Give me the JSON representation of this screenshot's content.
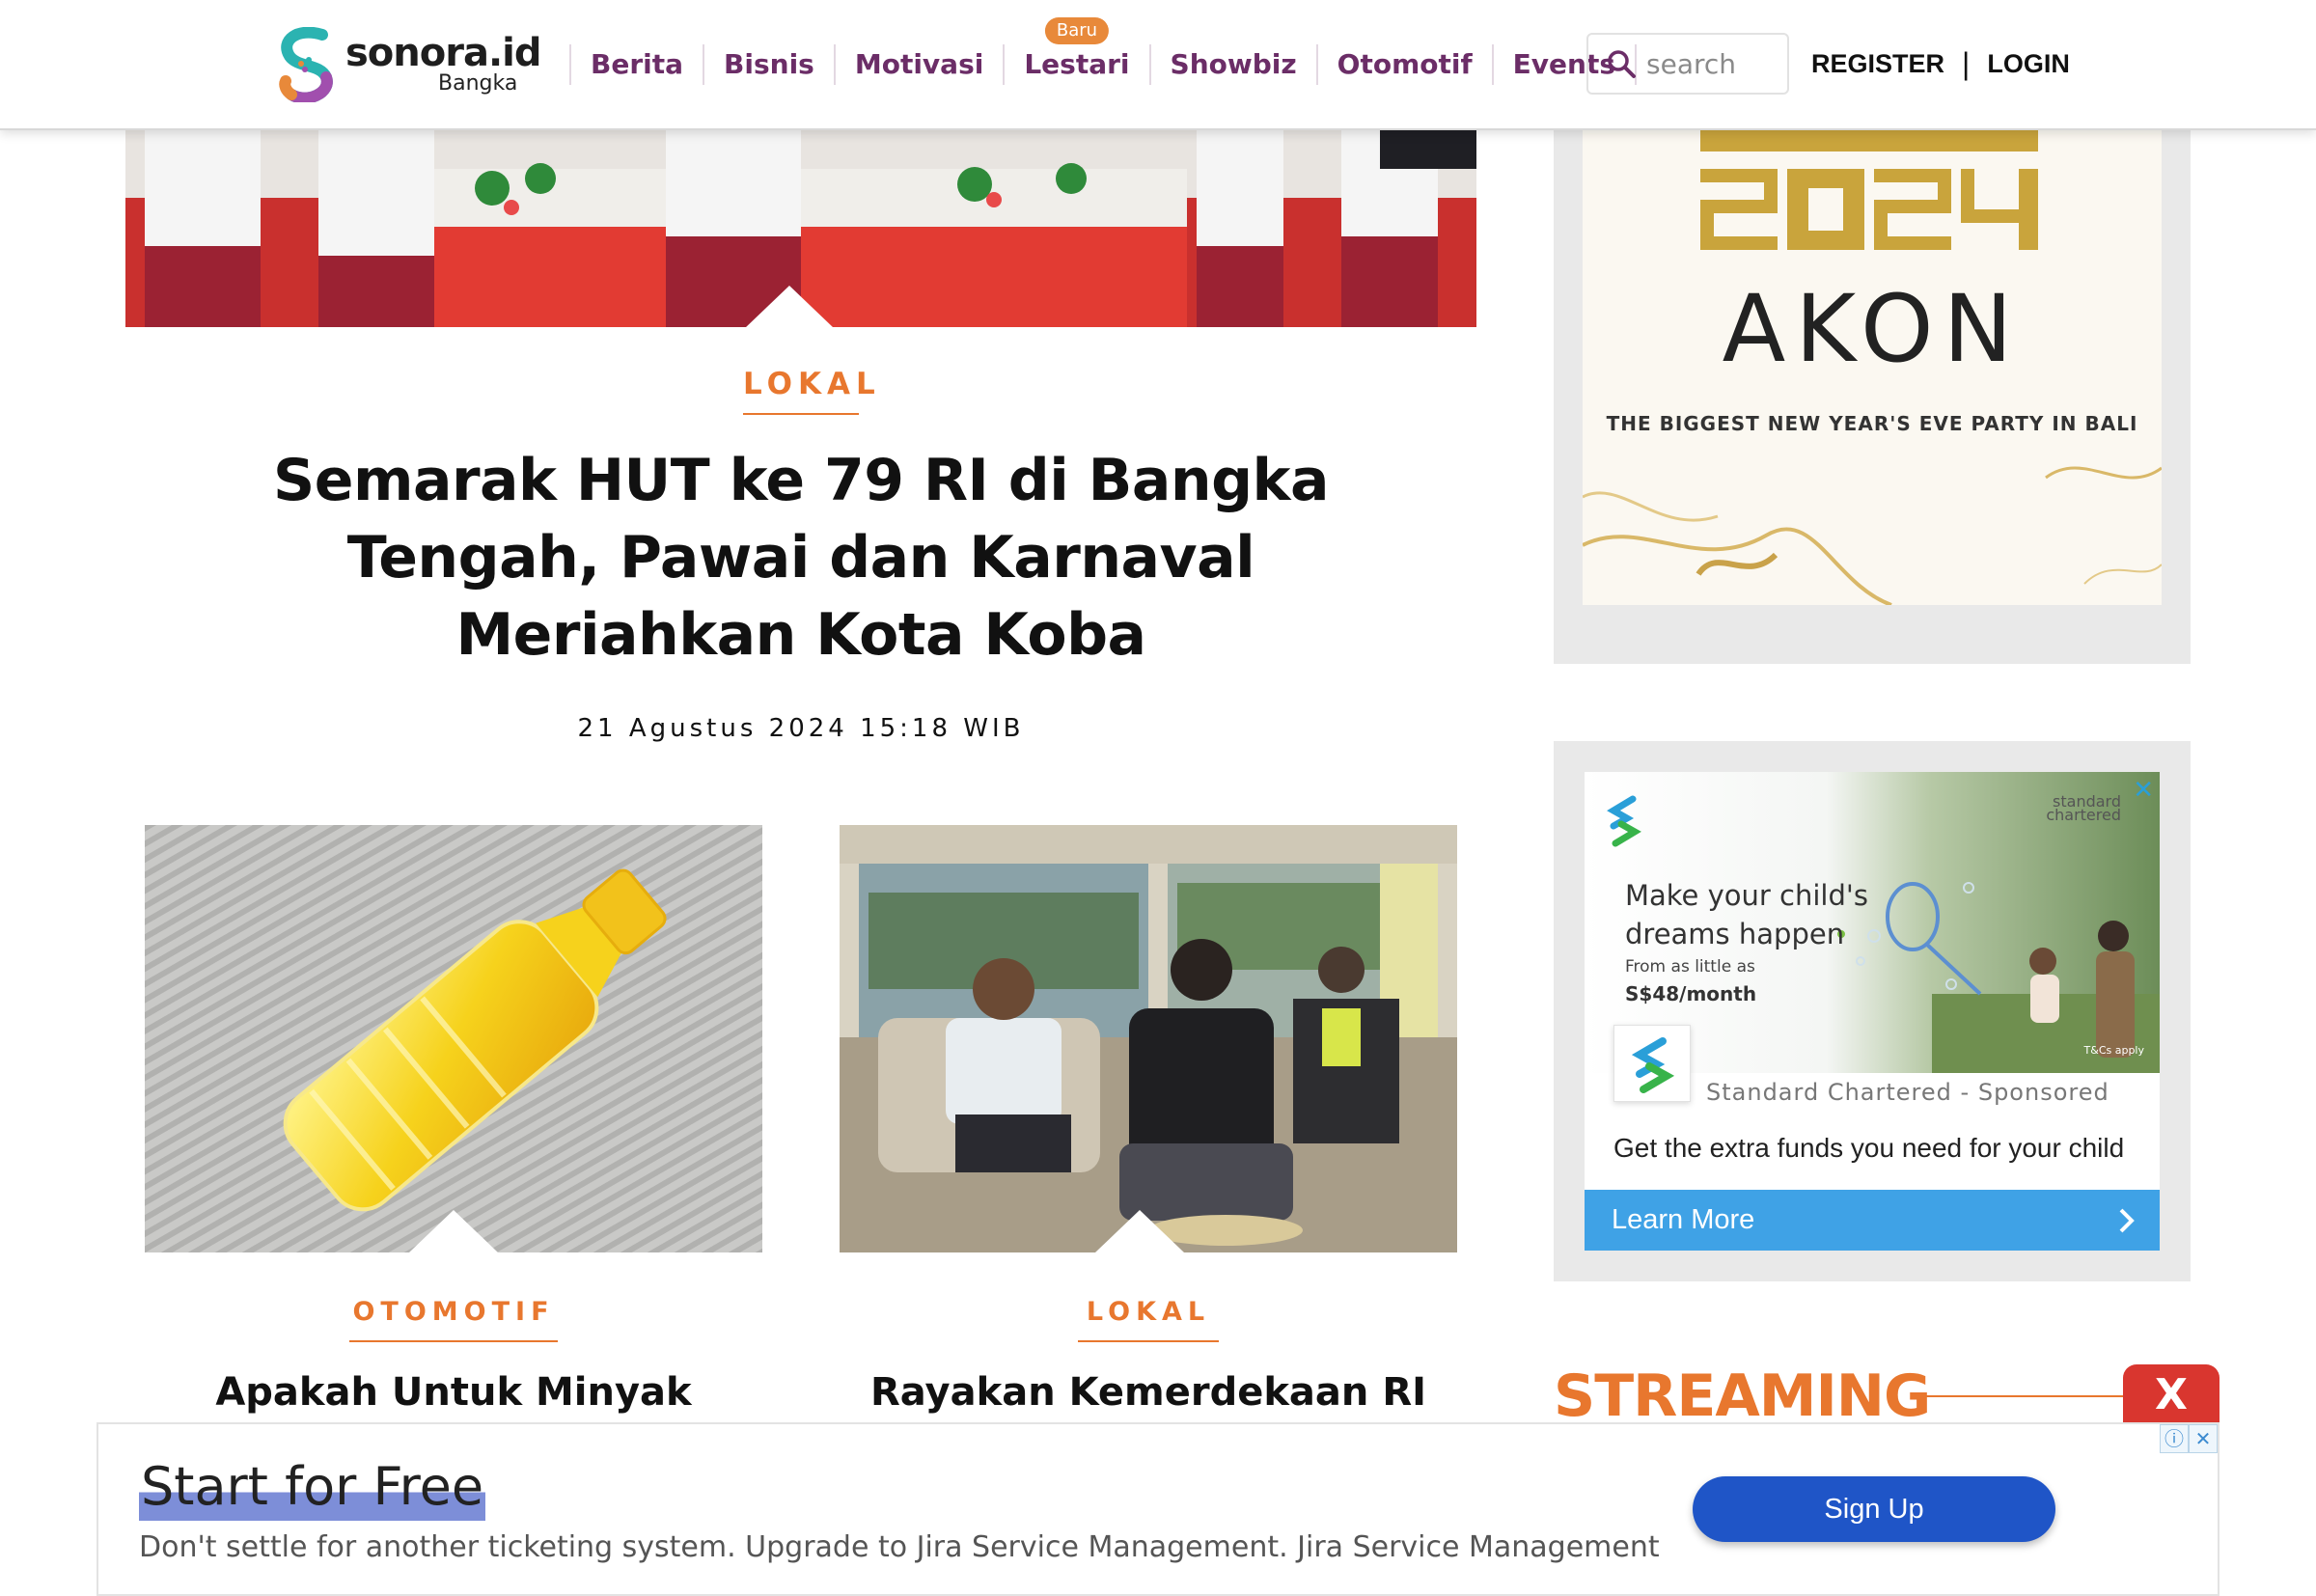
{
  "header": {
    "logo_word": "sonora.id",
    "logo_city": "Bangka",
    "nav": [
      {
        "label": "Berita",
        "badge": ""
      },
      {
        "label": "Bisnis",
        "badge": ""
      },
      {
        "label": "Motivasi",
        "badge": ""
      },
      {
        "label": "Lestari",
        "badge": "Baru"
      },
      {
        "label": "Showbiz",
        "badge": ""
      },
      {
        "label": "Otomotif",
        "badge": ""
      },
      {
        "label": "Events",
        "badge": ""
      }
    ],
    "search_placeholder": "search",
    "register": "REGISTER",
    "separator": "|",
    "login": "LOGIN"
  },
  "hero": {
    "category": "LOKAL",
    "title": "Semarak HUT ke 79 RI di Bangka Tengah, Pawai dan Karnaval Meriahkan Kota Koba",
    "date": "21 Agustus 2024 15:18 WIB"
  },
  "cards": [
    {
      "category": "OTOMOTIF",
      "title": "Apakah Untuk Minyak"
    },
    {
      "category": "LOKAL",
      "title": "Rayakan Kemerdekaan RI"
    }
  ],
  "sidebar": {
    "akon_ad": {
      "year": "2024",
      "name": "AKON",
      "tagline": "THE BIGGEST NEW YEAR'S EVE PARTY IN BALI"
    },
    "sc_ad": {
      "brand_top_1": "standard",
      "brand_top_2": "chartered",
      "headline": "Make your child's dreams happen",
      "price_label": "From as little as",
      "price": "S$48/month",
      "tc": "T&Cs apply",
      "sponsor_name": "Standard Chartered",
      "sponsor_sep": "-",
      "sponsor_tag": "Sponsored",
      "description": "Get the extra funds you need for your child",
      "cta": "Learn More",
      "close": "✕"
    },
    "streaming_title": "STREAMING",
    "close_label": "X"
  },
  "bottom_ad": {
    "title": "Start for Free",
    "description": "Don't settle for another ticketing system. Upgrade to Jira Service Management. Jira Service Management",
    "button": "Sign Up",
    "info_icon": "ⓘ",
    "close_icon": "✕"
  },
  "colors": {
    "nav_purple": "#6b2d67",
    "accent_orange": "#e8772e",
    "badge_orange": "#e8893a",
    "sc_blue": "#3fa2e6",
    "signup_blue": "#1f55c7",
    "close_red": "#d9362f"
  }
}
